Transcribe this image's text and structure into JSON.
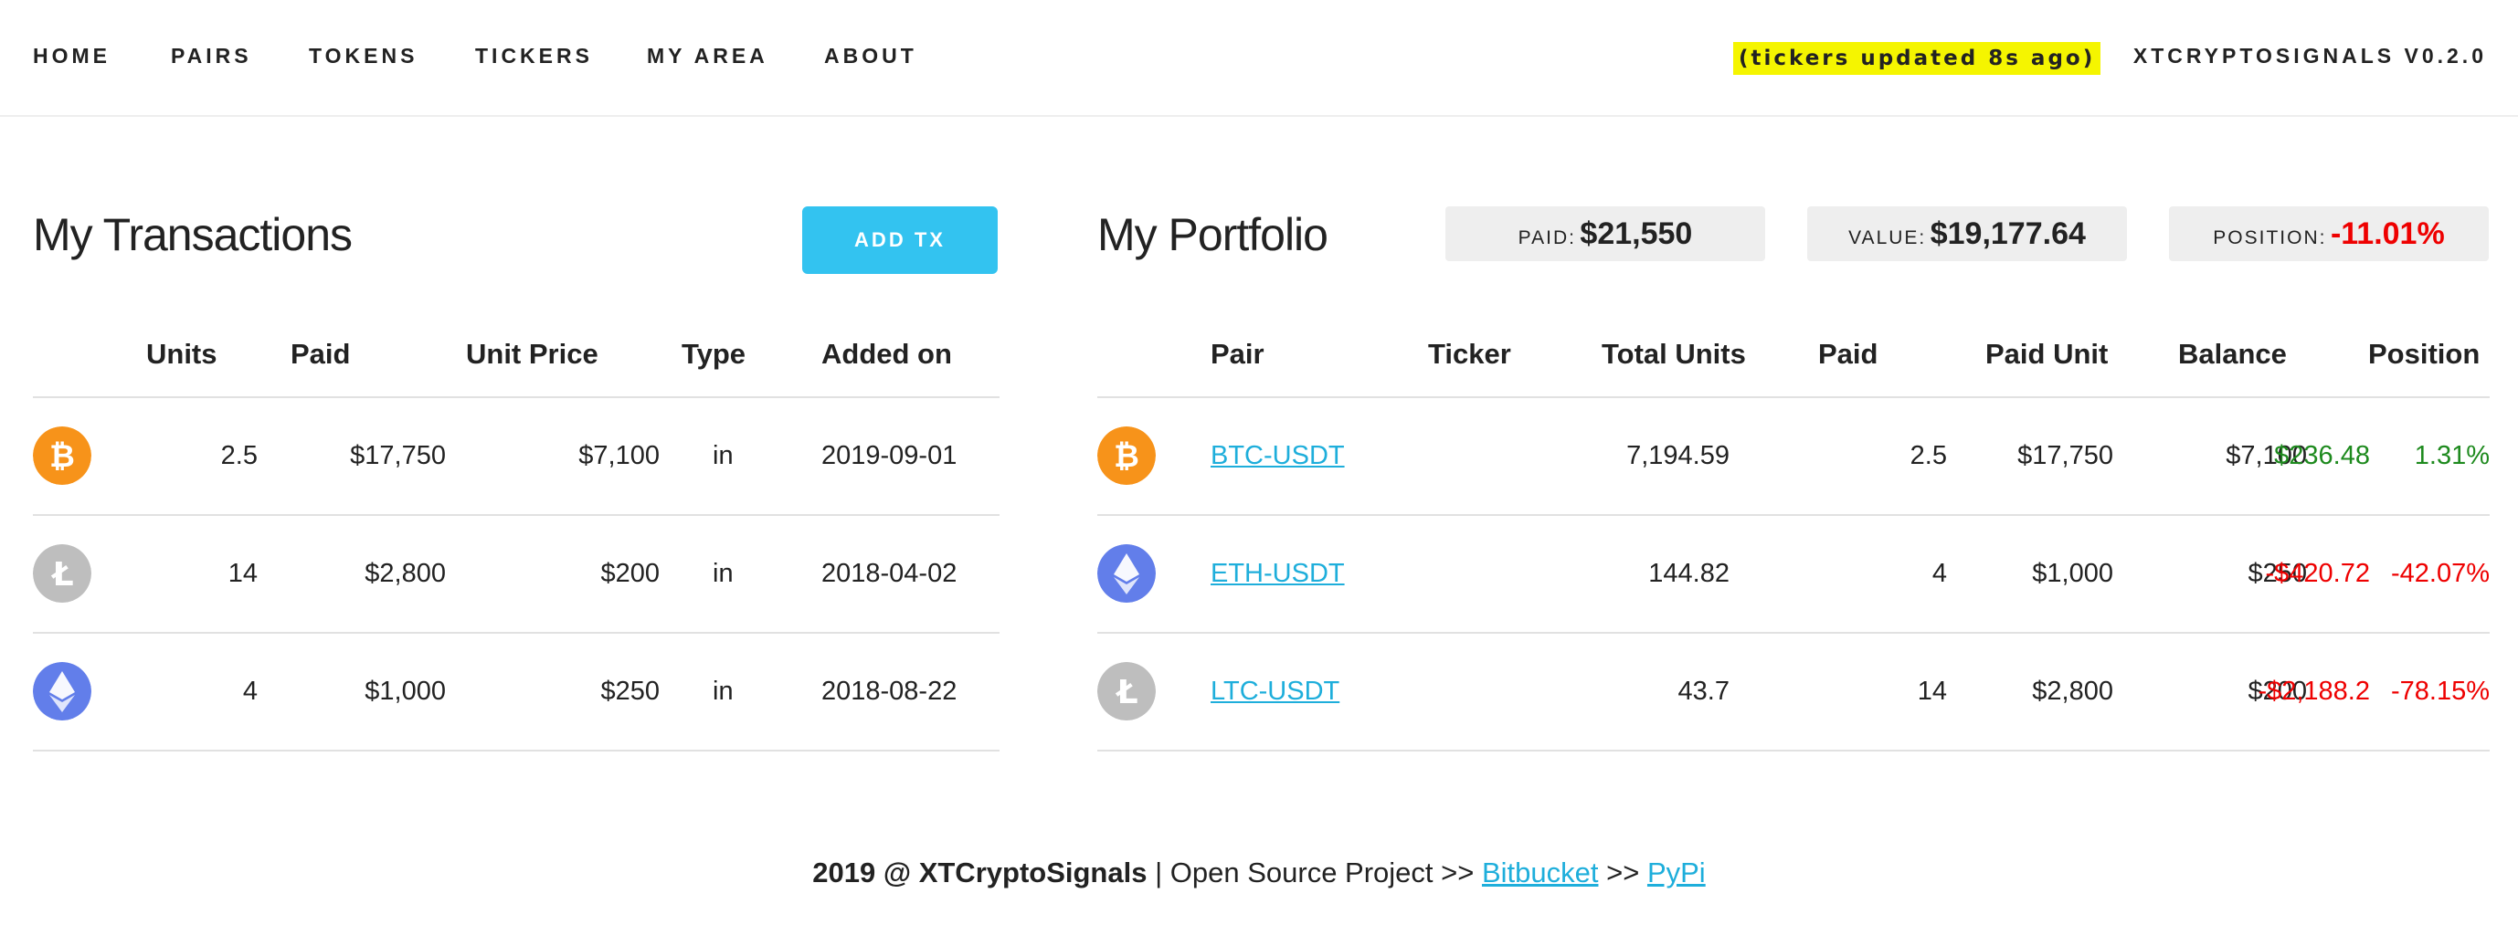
{
  "nav": {
    "items": [
      "HOME",
      "PAIRS",
      "TOKENS",
      "TICKERS",
      "MY AREA",
      "ABOUT"
    ],
    "ticker_note": "(tickers updated 8s ago)",
    "version": "XTCRYPTOSIGNALS V0.2.0"
  },
  "transactions": {
    "title": "My Transactions",
    "add_label": "ADD TX",
    "headers": [
      "Units",
      "Paid",
      "Unit Price",
      "Type",
      "Added on"
    ],
    "rows": [
      {
        "coin": "bitcoin-icon",
        "units": "2.5",
        "paid": "$17,750",
        "unit_price": "$7,100",
        "type": "in",
        "added_on": "2019-09-01"
      },
      {
        "coin": "litecoin-icon",
        "units": "14",
        "paid": "$2,800",
        "unit_price": "$200",
        "type": "in",
        "added_on": "2018-04-02"
      },
      {
        "coin": "ethereum-icon",
        "units": "4",
        "paid": "$1,000",
        "unit_price": "$250",
        "type": "in",
        "added_on": "2018-08-22"
      }
    ]
  },
  "portfolio": {
    "title": "My Portfolio",
    "paid_label": "PAID:",
    "paid_value": "$21,550",
    "value_label": "VALUE:",
    "value_value": "$19,177.64",
    "position_label": "POSITION:",
    "position_value": "-11.01%",
    "headers": [
      "Pair",
      "Ticker",
      "Total Units",
      "Paid",
      "Paid Unit",
      "Balance",
      "Position"
    ],
    "rows": [
      {
        "coin": "bitcoin-icon",
        "pair": "BTC-USDT",
        "ticker": "7,194.59",
        "total_units": "2.5",
        "paid": "$17,750",
        "paid_unit": "$7,100",
        "balance": "$236.48",
        "position": "1.31%",
        "trend": "up"
      },
      {
        "coin": "ethereum-icon",
        "pair": "ETH-USDT",
        "ticker": "144.82",
        "total_units": "4",
        "paid": "$1,000",
        "paid_unit": "$250",
        "balance": "-$420.72",
        "position": "-42.07%",
        "trend": "down"
      },
      {
        "coin": "litecoin-icon",
        "pair": "LTC-USDT",
        "ticker": "43.7",
        "total_units": "14",
        "paid": "$2,800",
        "paid_unit": "$200",
        "balance": "-$2,188.2",
        "position": "-78.15%",
        "trend": "down"
      }
    ]
  },
  "footer": {
    "brand": "2019 @ XTCryptoSignals",
    "text": "| Open Source Project >>",
    "link1": "Bitbucket",
    "sep": ">>",
    "link2": "PyPi"
  },
  "colors": {
    "accent": "#33c3f0",
    "link": "#1eaedb",
    "positive": "#1e8a1e",
    "negative": "#ee0000",
    "highlight": "#f5f500",
    "bitcoin": "#f7931a",
    "litecoin": "#bebebe",
    "ethereum": "#627eea"
  }
}
